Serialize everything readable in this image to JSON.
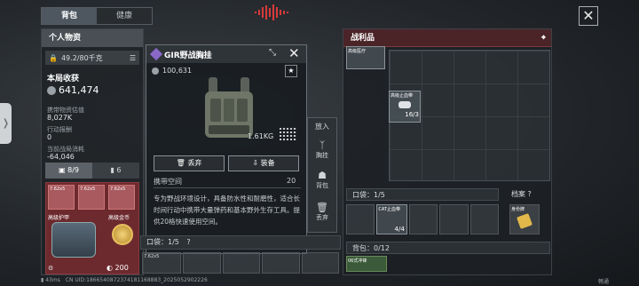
{
  "tabs": {
    "backpack": "背包",
    "health": "健康"
  },
  "left_panel": {
    "title": "个人物资",
    "capacity": "49.2/80千克",
    "income_label": "本局收获",
    "income_value": "641,474",
    "carry_value_label": "携带物资估值",
    "carry_value": "8,027K",
    "action_report_label": "行动报酬",
    "action_report_value": "0",
    "consumed_label": "当前战局消耗",
    "consumed_value": "-64,046",
    "slot_tab_1": "8/9",
    "slot_tab_2": "6",
    "mini_1": "7.62x5",
    "mini_2": "7.62x5",
    "mini_3": "7.62x5",
    "armor_label": "高级护甲",
    "gold_label": "高级金币",
    "count_bottom": "200"
  },
  "popup": {
    "title": "GIR野战胸挂",
    "price": "100,631",
    "weight": "1.61KG",
    "discard_label": "丢弃",
    "equip_label": "装备",
    "space_label": "携带空间",
    "space_value": "20",
    "description": "专为野战环境设计，具备防水性和耐磨性，适合长时间行动中携带大量弹药和基本野外生存工具。提供20格快速使用空间。"
  },
  "side_actions": {
    "put_in": "放入",
    "chest": "胸挂",
    "backpack": "背包",
    "discard": "丢弃"
  },
  "pocket": {
    "label": "口袋：1/5",
    "help": "?",
    "mini": "7.62x5"
  },
  "loot": {
    "title": "战利品",
    "item_top_left": "高级医疗",
    "item_bandage_label": "高级止血带",
    "item_bandage_count": "16/3",
    "pocket_label": "口袋：1/5",
    "cat_label": "CAT止血带",
    "cat_count": "4/4",
    "backpack_label": "背包：0/12",
    "green_label": "06式冲锋",
    "archive_label": "档案",
    "archive_help": "?",
    "id_label": "身份牌"
  },
  "status_bar": {
    "ping": "43ms",
    "uid": "CN UID:1866540872374181168883_2025052902226",
    "right": "畅通"
  },
  "colors": {
    "accent_red": "#c0392b",
    "diamond": "#8a68c8"
  }
}
